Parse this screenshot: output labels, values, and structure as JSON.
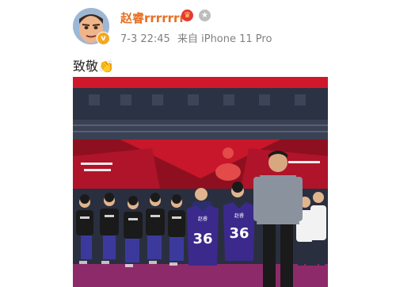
{
  "post": {
    "username": "赵睿rrrrrrr",
    "badge_icons": [
      "crown-badge-icon",
      "silver-medal-badge-icon"
    ],
    "timestamp": "7-3 22:45",
    "source": "来自 iPhone 11 Pro",
    "text": "致敬👏",
    "verified_icon": "verified-v-icon",
    "photo": {
      "jersey_left": {
        "number": "36",
        "name": "赵睿"
      },
      "jersey_right": {
        "number": "36",
        "name": "赵睿"
      }
    }
  },
  "colors": {
    "username": "#e86f21",
    "meta": "#808080",
    "arena_red": "#d0182a",
    "jersey_purple": "#3b2a8c"
  }
}
